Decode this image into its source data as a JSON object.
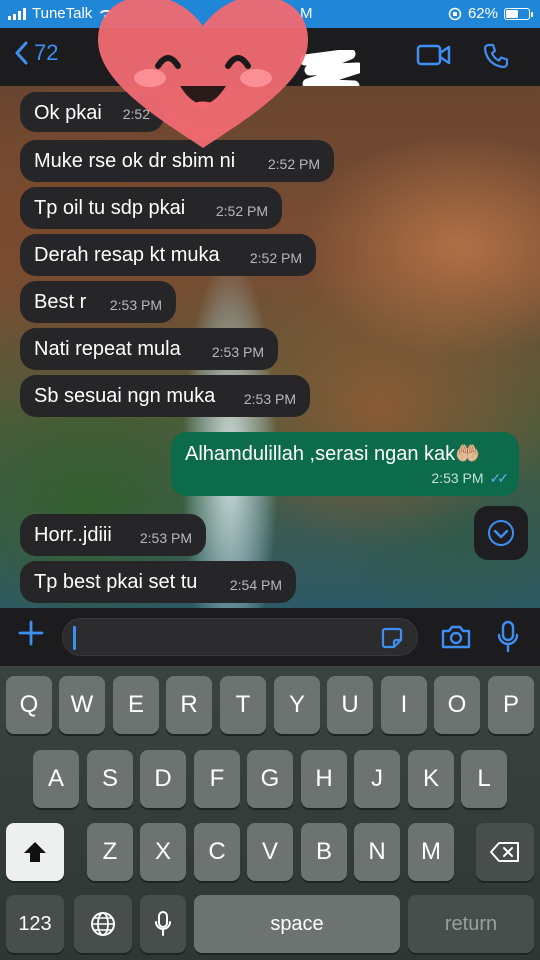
{
  "status_bar": {
    "carrier": "TuneTalk",
    "time_fragment": "M",
    "battery": "62%",
    "battery_level": 0.62
  },
  "header": {
    "back_count": "72"
  },
  "messages": [
    {
      "text": "Ok pkai",
      "time": "2:52",
      "dir": "in"
    },
    {
      "text": "Muke rse ok dr sbim ni",
      "time": "2:52 PM",
      "dir": "in"
    },
    {
      "text": "Tp oil tu sdp pkai",
      "time": "2:52 PM",
      "dir": "in"
    },
    {
      "text": "Derah resap kt muka",
      "time": "2:52 PM",
      "dir": "in"
    },
    {
      "text": "Best r",
      "time": "2:53 PM",
      "dir": "in"
    },
    {
      "text": "Nati repeat mula",
      "time": "2:53 PM",
      "dir": "in"
    },
    {
      "text": "Sb sesuai ngn muka",
      "time": "2:53 PM",
      "dir": "in"
    },
    {
      "text": "Alhamdulillah ,serasi ngan kak🤲🏼",
      "time": "2:53 PM",
      "dir": "out"
    },
    {
      "text": "Horr..jdiii",
      "time": "2:53 PM",
      "dir": "in"
    },
    {
      "text": "Tp best pkai set tu",
      "time": "2:54 PM",
      "dir": "in"
    }
  ],
  "keyboard": {
    "row1": [
      "Q",
      "W",
      "E",
      "R",
      "T",
      "Y",
      "U",
      "I",
      "O",
      "P"
    ],
    "row2": [
      "A",
      "S",
      "D",
      "F",
      "G",
      "H",
      "J",
      "K",
      "L"
    ],
    "row3": [
      "Z",
      "X",
      "C",
      "V",
      "B",
      "N",
      "M"
    ],
    "numbers": "123",
    "space": "space",
    "return": "return"
  },
  "colors": {
    "status_bar": "#1f86d8",
    "incoming_bubble": "#262628",
    "outgoing_bubble": "#0c6b4a",
    "accent": "#3e8ff3",
    "read_ticks": "#5fb7f5"
  },
  "icons": [
    "back-chevron-icon",
    "video-call-icon",
    "voice-call-icon",
    "plus-icon",
    "sticker-icon",
    "camera-icon",
    "microphone-icon",
    "scroll-down-icon",
    "shift-icon",
    "backspace-icon",
    "globe-icon",
    "keyboard-mic-icon",
    "heart-emoji-sticker"
  ]
}
